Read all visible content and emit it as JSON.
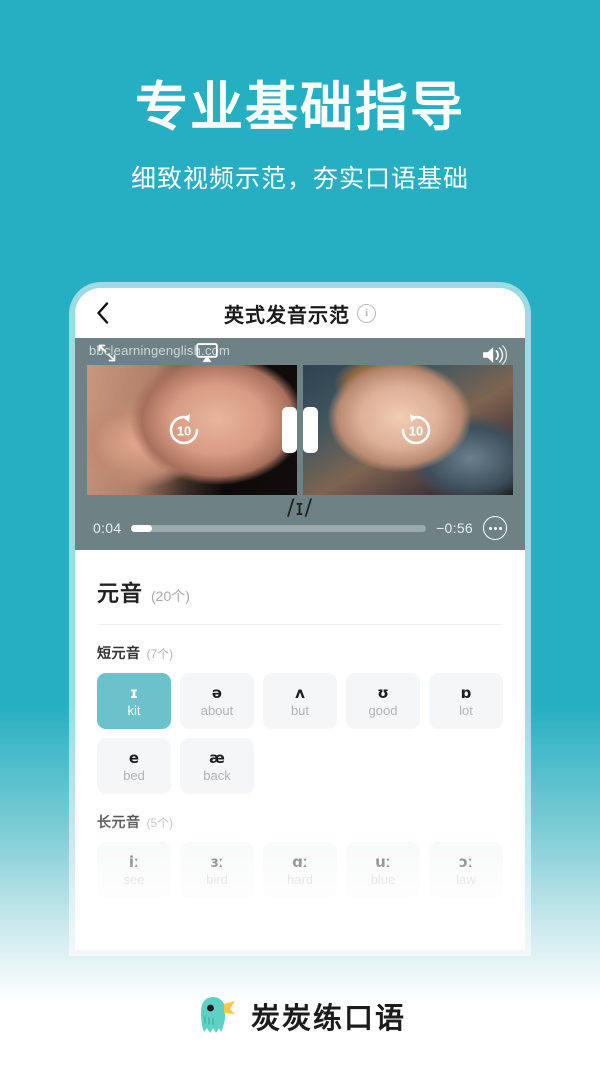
{
  "hero": {
    "title": "专业基础指导",
    "subtitle": "细致视频示范，夯实口语基础"
  },
  "phone": {
    "navbar": {
      "back_icon": "chevron-left-icon",
      "title": "英式发音示范",
      "info_icon": "info-icon",
      "info_label": "i"
    },
    "video": {
      "watermark": "bbclearningenglish.com",
      "expand_icon": "expand-icon",
      "airplay_icon": "airplay-icon",
      "volume_icon": "volume-icon",
      "rewind_icon": "rewind-10-icon",
      "rewind_label": "10",
      "forward_icon": "forward-10-icon",
      "forward_label": "10",
      "pause_icon": "pause-icon",
      "phonetic": "/ɪ/",
      "current_time": "0:04",
      "remaining_time": "−0:56",
      "progress_percent": 7,
      "more_icon": "more-options-icon"
    },
    "vowels": {
      "section_title": "元音",
      "section_count": "(20个)",
      "short": {
        "title": "短元音",
        "count": "(7个)",
        "tiles": [
          {
            "ipa": "ɪ",
            "word": "kit",
            "selected": true
          },
          {
            "ipa": "ə",
            "word": "about",
            "selected": false
          },
          {
            "ipa": "ʌ",
            "word": "but",
            "selected": false
          },
          {
            "ipa": "ʊ",
            "word": "good",
            "selected": false
          },
          {
            "ipa": "ɒ",
            "word": "lot",
            "selected": false
          },
          {
            "ipa": "e",
            "word": "bed",
            "selected": false
          },
          {
            "ipa": "æ",
            "word": "back",
            "selected": false
          }
        ]
      },
      "long": {
        "title": "长元音",
        "count": "(5个)",
        "tiles": [
          {
            "ipa": "iː",
            "word": "see",
            "selected": false
          },
          {
            "ipa": "ɜː",
            "word": "bird",
            "selected": false
          },
          {
            "ipa": "ɑː",
            "word": "hard",
            "selected": false
          },
          {
            "ipa": "uː",
            "word": "blue",
            "selected": false
          },
          {
            "ipa": "ɔː",
            "word": "law",
            "selected": false
          }
        ]
      }
    }
  },
  "footer": {
    "logo_icon": "bird-mascot-logo",
    "brand": "炭炭练口语"
  },
  "colors": {
    "bg_teal": "#26afc2",
    "tile_selected": "#6cc1cb",
    "tile_idle": "#f5f6f7",
    "video_bg": "#6e8286"
  }
}
